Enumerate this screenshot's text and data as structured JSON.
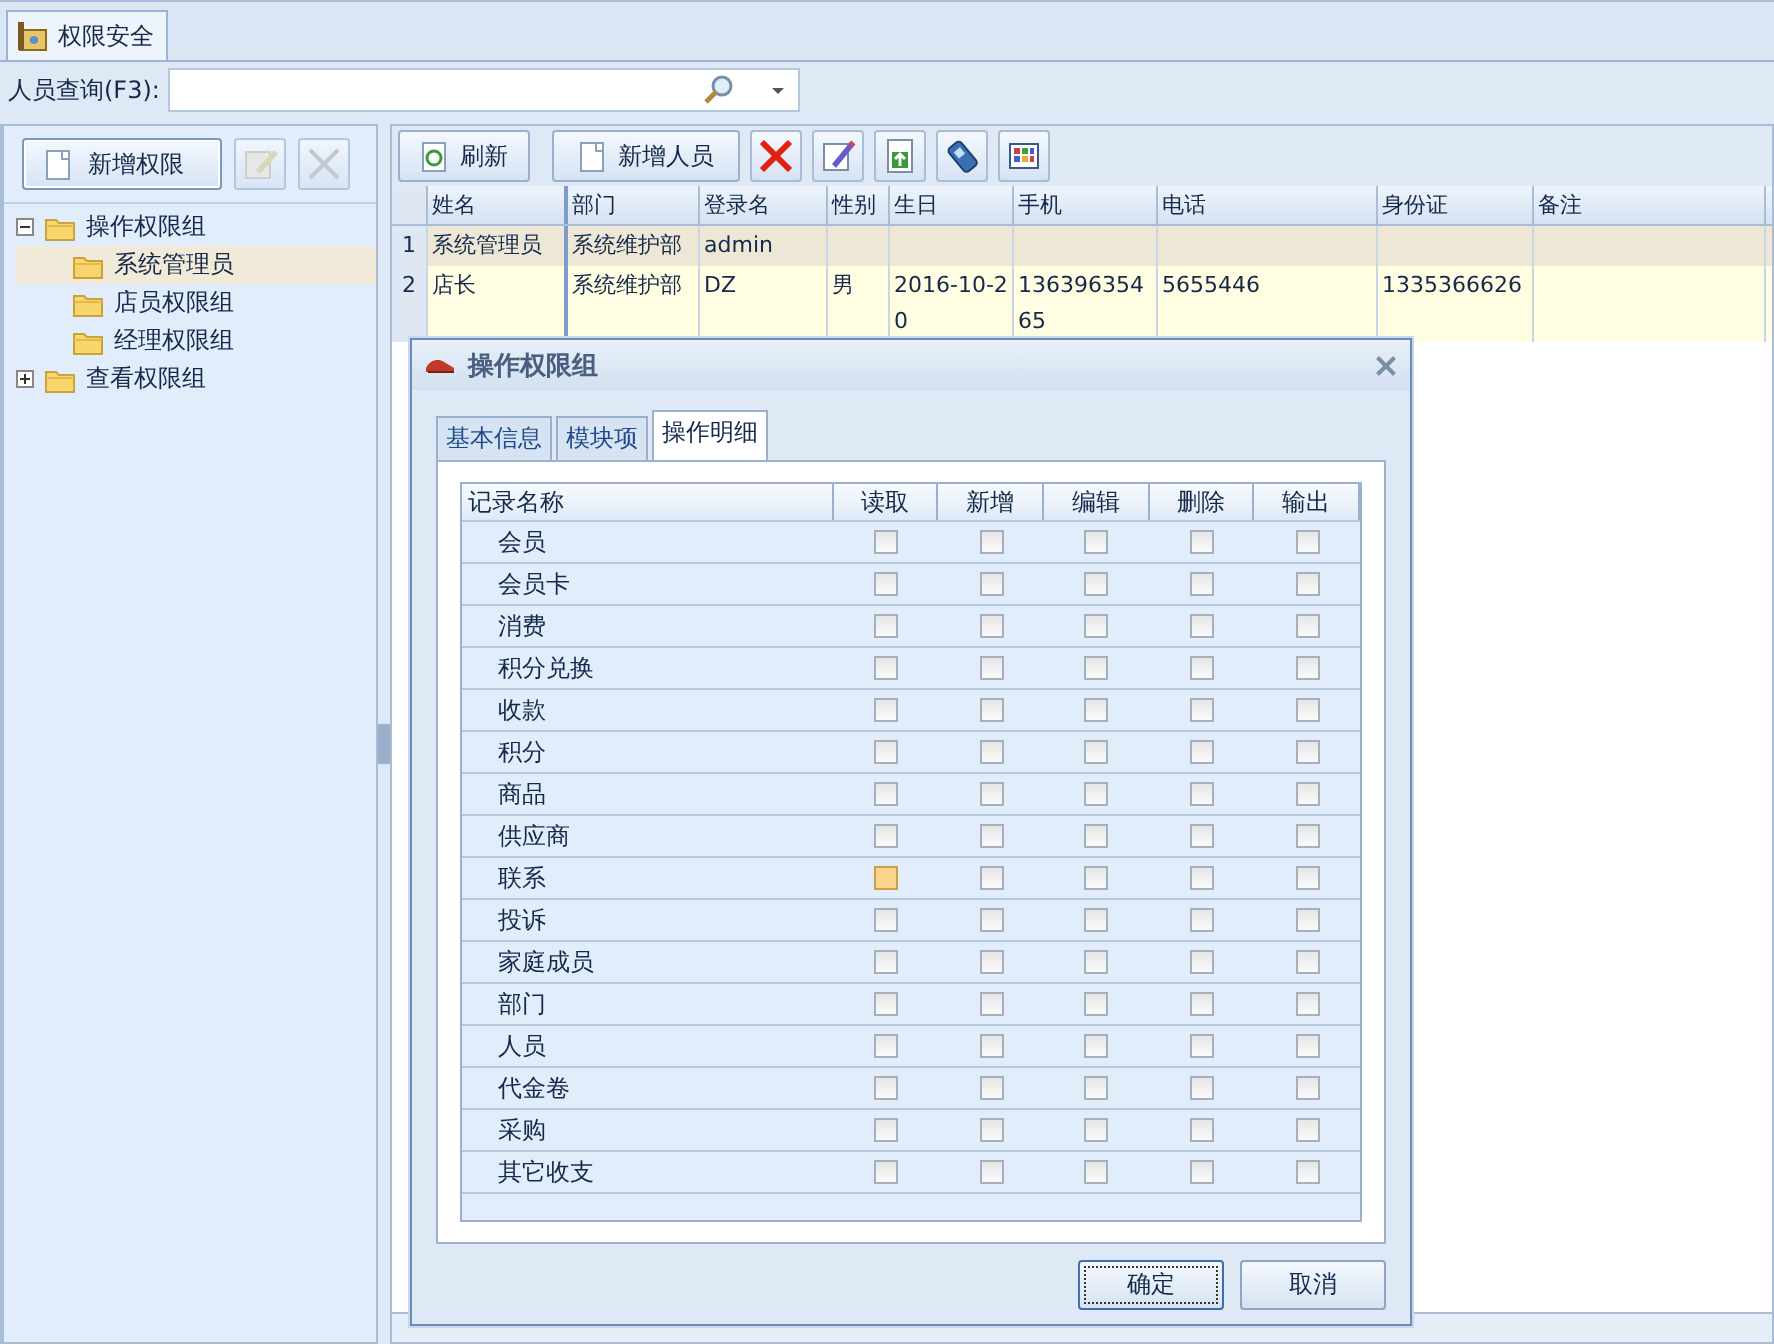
{
  "doc_tab": {
    "label": "权限安全",
    "selected": true
  },
  "search": {
    "label": "人员查询(F3):"
  },
  "left_toolbar": {
    "add_label": "新增权限"
  },
  "tree": [
    {
      "label": "操作权限组",
      "expanded": true,
      "selected": false,
      "children": [
        {
          "label": "系统管理员",
          "selected": true
        },
        {
          "label": "店员权限组",
          "selected": false
        },
        {
          "label": "经理权限组",
          "selected": false
        }
      ]
    },
    {
      "label": "查看权限组",
      "expanded": false,
      "selected": false
    }
  ],
  "toolbar": {
    "refresh_label": "刷新",
    "add_label": "新增人员"
  },
  "table": {
    "columns": [
      "姓名",
      "部门",
      "登录名",
      "性别",
      "生日",
      "手机",
      "电话",
      "身份证",
      "备注"
    ],
    "rows": [
      {
        "index": "1",
        "selected": true,
        "cells": [
          "系统管理员",
          "系统维护部",
          "admin",
          "",
          "",
          "",
          "",
          "",
          ""
        ]
      },
      {
        "index": "2",
        "selected": false,
        "cells": [
          "店长",
          "系统维护部",
          "DZ",
          "男",
          "2016-10-20",
          "13639635465",
          "5655446",
          "1335366626",
          ""
        ]
      }
    ]
  },
  "dialog": {
    "title": "操作权限组",
    "tabs": [
      {
        "label": "基本信息",
        "selected": false
      },
      {
        "label": "模块项",
        "selected": false
      },
      {
        "label": "操作明细",
        "selected": true
      }
    ],
    "grid": {
      "columns": [
        "记录名称",
        "读取",
        "新增",
        "编辑",
        "删除",
        "输出"
      ],
      "rows": [
        {
          "name": "会员",
          "checks": [
            {
              "checked": false,
              "hot": false
            },
            {
              "checked": false,
              "hot": false
            },
            {
              "checked": false,
              "hot": false
            },
            {
              "checked": false,
              "hot": false
            },
            {
              "checked": false,
              "hot": false
            }
          ]
        },
        {
          "name": "会员卡",
          "checks": [
            {
              "checked": false,
              "hot": false
            },
            {
              "checked": false,
              "hot": false
            },
            {
              "checked": false,
              "hot": false
            },
            {
              "checked": false,
              "hot": false
            },
            {
              "checked": false,
              "hot": false
            }
          ]
        },
        {
          "name": "消费",
          "checks": [
            {
              "checked": false,
              "hot": false
            },
            {
              "checked": false,
              "hot": false
            },
            {
              "checked": false,
              "hot": false
            },
            {
              "checked": false,
              "hot": false
            },
            {
              "checked": false,
              "hot": false
            }
          ]
        },
        {
          "name": "积分兑换",
          "checks": [
            {
              "checked": false,
              "hot": false
            },
            {
              "checked": false,
              "hot": false
            },
            {
              "checked": false,
              "hot": false
            },
            {
              "checked": false,
              "hot": false
            },
            {
              "checked": false,
              "hot": false
            }
          ]
        },
        {
          "name": "收款",
          "checks": [
            {
              "checked": false,
              "hot": false
            },
            {
              "checked": false,
              "hot": false
            },
            {
              "checked": false,
              "hot": false
            },
            {
              "checked": false,
              "hot": false
            },
            {
              "checked": false,
              "hot": false
            }
          ]
        },
        {
          "name": "积分",
          "checks": [
            {
              "checked": false,
              "hot": false
            },
            {
              "checked": false,
              "hot": false
            },
            {
              "checked": false,
              "hot": false
            },
            {
              "checked": false,
              "hot": false
            },
            {
              "checked": false,
              "hot": false
            }
          ]
        },
        {
          "name": "商品",
          "checks": [
            {
              "checked": false,
              "hot": false
            },
            {
              "checked": false,
              "hot": false
            },
            {
              "checked": false,
              "hot": false
            },
            {
              "checked": false,
              "hot": false
            },
            {
              "checked": false,
              "hot": false
            }
          ]
        },
        {
          "name": "供应商",
          "checks": [
            {
              "checked": false,
              "hot": false
            },
            {
              "checked": false,
              "hot": false
            },
            {
              "checked": false,
              "hot": false
            },
            {
              "checked": false,
              "hot": false
            },
            {
              "checked": false,
              "hot": false
            }
          ]
        },
        {
          "name": "联系",
          "checks": [
            {
              "checked": false,
              "hot": true
            },
            {
              "checked": false,
              "hot": false
            },
            {
              "checked": false,
              "hot": false
            },
            {
              "checked": false,
              "hot": false
            },
            {
              "checked": false,
              "hot": false
            }
          ]
        },
        {
          "name": "投诉",
          "checks": [
            {
              "checked": false,
              "hot": false
            },
            {
              "checked": false,
              "hot": false
            },
            {
              "checked": false,
              "hot": false
            },
            {
              "checked": false,
              "hot": false
            },
            {
              "checked": false,
              "hot": false
            }
          ]
        },
        {
          "name": "家庭成员",
          "checks": [
            {
              "checked": false,
              "hot": false
            },
            {
              "checked": false,
              "hot": false
            },
            {
              "checked": false,
              "hot": false
            },
            {
              "checked": false,
              "hot": false
            },
            {
              "checked": false,
              "hot": false
            }
          ]
        },
        {
          "name": "部门",
          "checks": [
            {
              "checked": false,
              "hot": false
            },
            {
              "checked": false,
              "hot": false
            },
            {
              "checked": false,
              "hot": false
            },
            {
              "checked": false,
              "hot": false
            },
            {
              "checked": false,
              "hot": false
            }
          ]
        },
        {
          "name": "人员",
          "checks": [
            {
              "checked": false,
              "hot": false
            },
            {
              "checked": false,
              "hot": false
            },
            {
              "checked": false,
              "hot": false
            },
            {
              "checked": false,
              "hot": false
            },
            {
              "checked": false,
              "hot": false
            }
          ]
        },
        {
          "name": "代金卷",
          "checks": [
            {
              "checked": false,
              "hot": false
            },
            {
              "checked": false,
              "hot": false
            },
            {
              "checked": false,
              "hot": false
            },
            {
              "checked": false,
              "hot": false
            },
            {
              "checked": false,
              "hot": false
            }
          ]
        },
        {
          "name": "采购",
          "checks": [
            {
              "checked": false,
              "hot": false
            },
            {
              "checked": false,
              "hot": false
            },
            {
              "checked": false,
              "hot": false
            },
            {
              "checked": false,
              "hot": false
            },
            {
              "checked": false,
              "hot": false
            }
          ]
        },
        {
          "name": "其它收支",
          "checks": [
            {
              "checked": false,
              "hot": false
            },
            {
              "checked": false,
              "hot": false
            },
            {
              "checked": false,
              "hot": false
            },
            {
              "checked": false,
              "hot": false
            },
            {
              "checked": false,
              "hot": false
            }
          ]
        }
      ]
    },
    "buttons": [
      {
        "label": "确定",
        "focused": true
      },
      {
        "label": "取消",
        "focused": false
      }
    ]
  }
}
